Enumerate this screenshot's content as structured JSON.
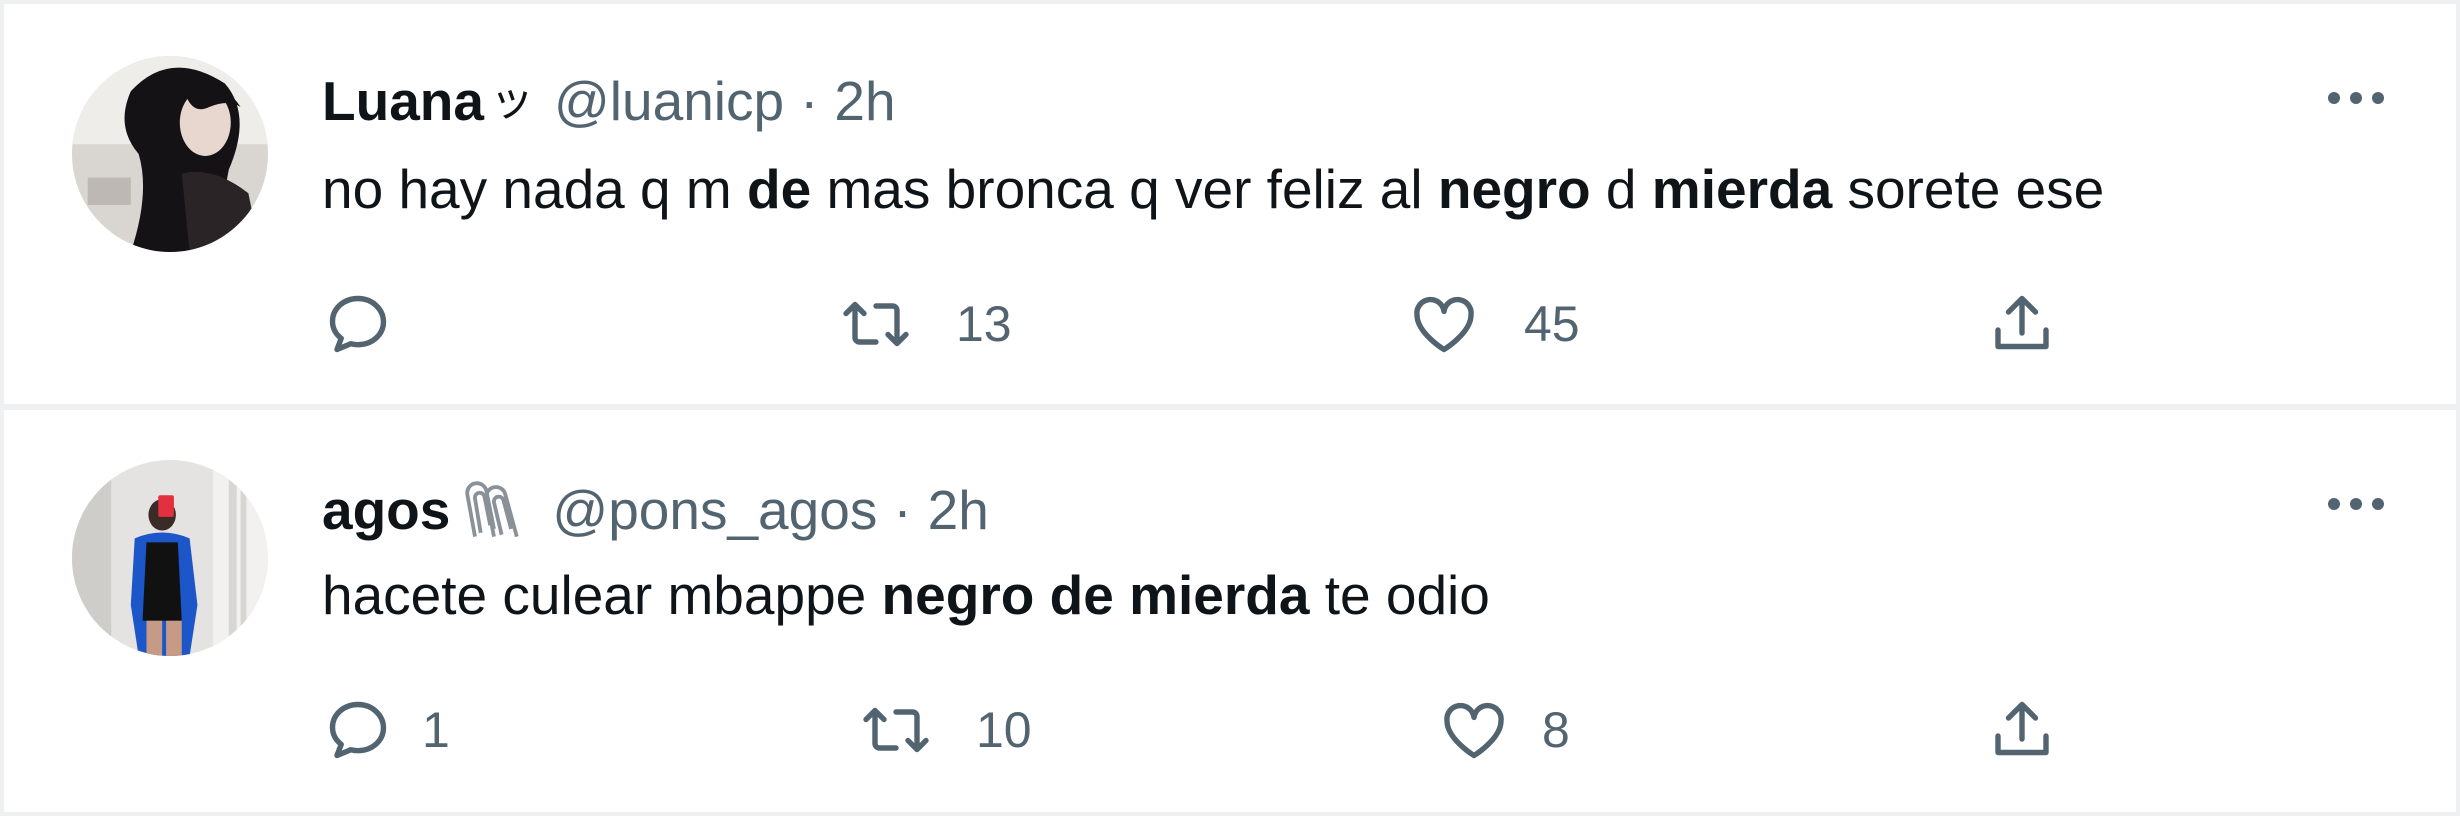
{
  "tweets": [
    {
      "author_name": "Luana",
      "author_emoji": "ッ",
      "handle": "@luanicp",
      "separator": "·",
      "time": "2h",
      "text_segments": [
        {
          "t": "no hay nada q m ",
          "b": false
        },
        {
          "t": "de",
          "b": true
        },
        {
          "t": " mas bronca q ver feliz al ",
          "b": false
        },
        {
          "t": "negro",
          "b": true
        },
        {
          "t": " d ",
          "b": false
        },
        {
          "t": "mierda",
          "b": true
        },
        {
          "t": " sorete ese",
          "b": false
        }
      ],
      "counts": {
        "reply": "",
        "retweet": "13",
        "like": "45"
      }
    },
    {
      "author_name": "agos",
      "author_emoji": "paperclips",
      "handle": "@pons_agos",
      "separator": "·",
      "time": "2h",
      "text_segments": [
        {
          "t": "hacete culear mbappe ",
          "b": false
        },
        {
          "t": "negro de mierda",
          "b": true
        },
        {
          "t": " te odio",
          "b": false
        }
      ],
      "counts": {
        "reply": "1",
        "retweet": "10",
        "like": "8"
      }
    }
  ],
  "icons": [
    "reply-icon",
    "retweet-icon",
    "like-icon",
    "share-icon",
    "more-icon"
  ],
  "colors": {
    "text": "#0f1419",
    "secondary": "#536471",
    "background": "#ffffff",
    "divider": "#eef0f2"
  }
}
